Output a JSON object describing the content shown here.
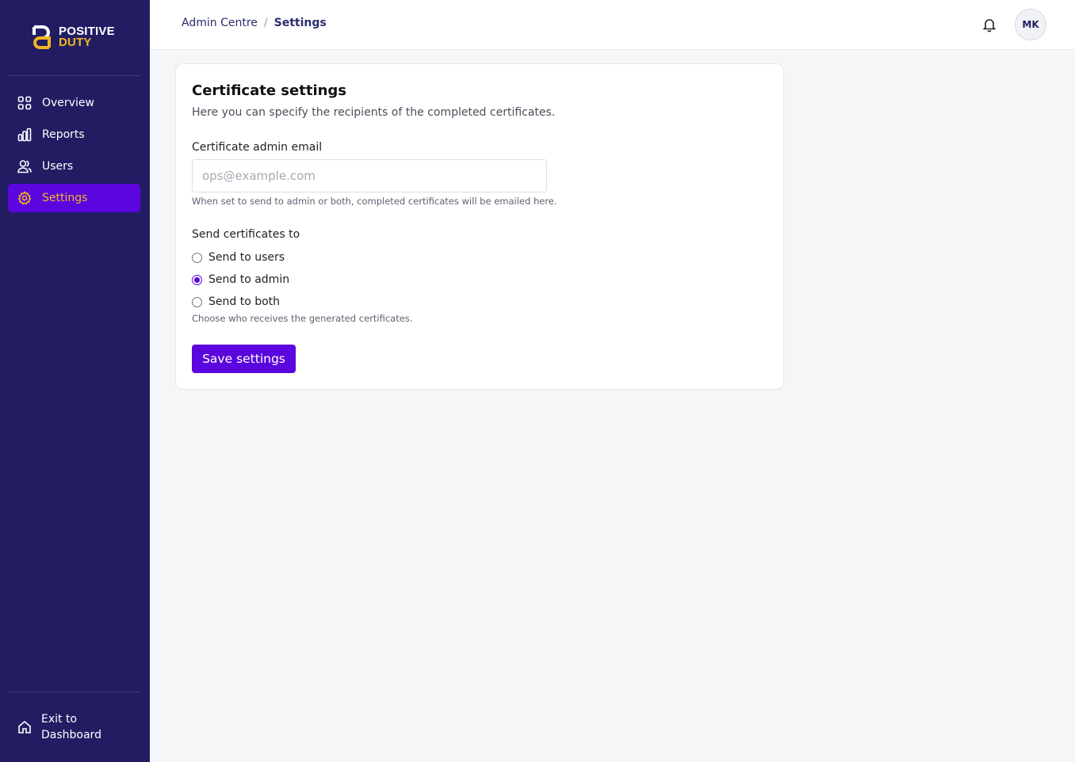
{
  "brand": {
    "line1": "POSITIVE",
    "line2": "DUTY",
    "accent_color": "#f2b51f",
    "sidebar_color": "#221d63",
    "primary_color": "#5b06de"
  },
  "sidebar": {
    "items": [
      {
        "label": "Overview",
        "icon": "grid-icon",
        "active": false
      },
      {
        "label": "Reports",
        "icon": "bar-chart-icon",
        "active": false
      },
      {
        "label": "Users",
        "icon": "users-icon",
        "active": false
      },
      {
        "label": "Settings",
        "icon": "gear-icon",
        "active": true
      }
    ],
    "exit_label_line1": "Exit to",
    "exit_label_line2": "Dashboard"
  },
  "header": {
    "breadcrumb_root": "Admin Centre",
    "breadcrumb_sep": "/",
    "breadcrumb_current": "Settings",
    "avatar_initials": "MK"
  },
  "card": {
    "title": "Certificate settings",
    "subtitle": "Here you can specify the recipients of the completed certificates.",
    "email_label": "Certificate admin email",
    "email_placeholder": "ops@example.com",
    "email_value": "",
    "email_help": "When set to send to admin or both, completed certificates will be emailed here.",
    "send_label": "Send certificates to",
    "options": [
      {
        "label": "Send to users",
        "checked": false
      },
      {
        "label": "Send to admin",
        "checked": true
      },
      {
        "label": "Send to both",
        "checked": false
      }
    ],
    "send_help": "Choose who receives the generated certificates.",
    "save_label": "Save settings"
  }
}
